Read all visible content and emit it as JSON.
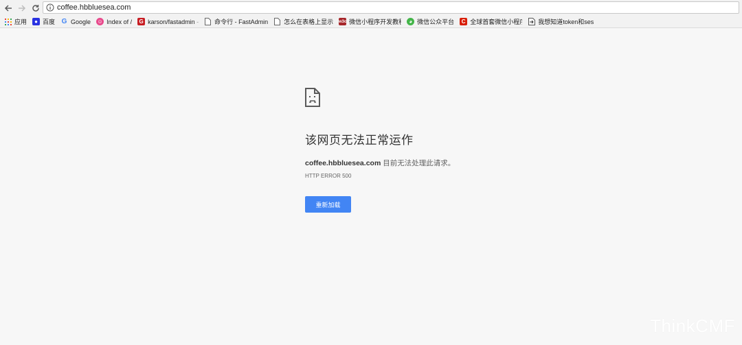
{
  "toolbar": {
    "url": "coffee.hbbluesea.com"
  },
  "bookmarks": [
    {
      "label": "应用",
      "icon": "apps-grid-icon",
      "color": "#4285f4"
    },
    {
      "label": "百度",
      "icon": "baidu-icon",
      "color": "#2932e1"
    },
    {
      "label": "Google",
      "icon": "google-icon",
      "color": "#4285f4"
    },
    {
      "label": "Index of /",
      "icon": "site-icon",
      "color": "#e84a8c"
    },
    {
      "label": "karson/fastadmin",
      "icon": "gitee-icon",
      "color": "#c71d23"
    },
    {
      "label": "命令行 - FastAdmin",
      "icon": "page-icon",
      "color": "#888888"
    },
    {
      "label": "怎么在表格上显示",
      "icon": "page-icon",
      "color": "#888888"
    },
    {
      "label": "微信小程序开发教程",
      "icon": "w3c-icon",
      "color": "#a6262a"
    },
    {
      "label": "微信公众平台",
      "icon": "wechat-icon",
      "color": "#44b549"
    },
    {
      "label": "全球首套微信小程序",
      "icon": "c-icon",
      "color": "#d81e06"
    },
    {
      "label": "我想知道token和ses",
      "icon": "arrow-page-icon",
      "color": "#555555"
    }
  ],
  "error": {
    "title": "该网页无法正常运作",
    "host": "coffee.hbbluesea.com",
    "message": " 目前无法处理此请求。",
    "code": "HTTP ERROR 500",
    "reload_label": "重新加载"
  },
  "watermark": "ThinkCMF"
}
